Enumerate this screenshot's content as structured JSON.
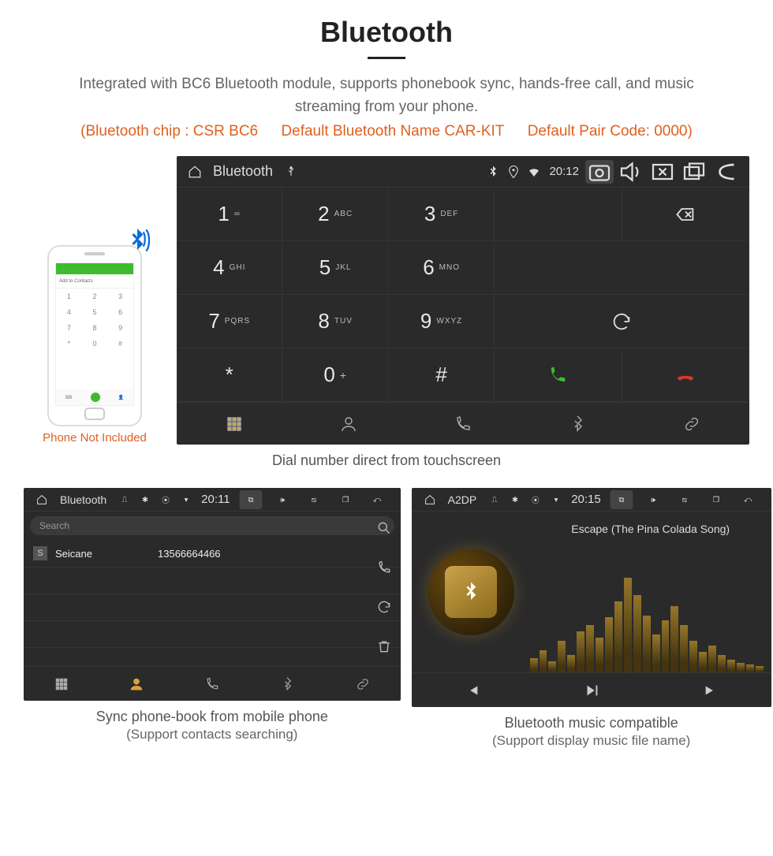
{
  "header": {
    "title": "Bluetooth",
    "subtitle": "Integrated with BC6 Bluetooth module, supports phonebook sync, hands-free call, and music streaming from your phone.",
    "spec_chip": "(Bluetooth chip : CSR BC6",
    "spec_name": "Default Bluetooth Name CAR-KIT",
    "spec_code": "Default Pair Code: 0000)"
  },
  "phone_mock": {
    "add_contacts": "Add to Contacts",
    "caption": "Phone Not Included"
  },
  "main_panel": {
    "statusbar": {
      "title": "Bluetooth",
      "time": "20:12"
    },
    "keys": [
      {
        "digit": "1",
        "letters": "∞"
      },
      {
        "digit": "2",
        "letters": "ABC"
      },
      {
        "digit": "3",
        "letters": "DEF"
      },
      {
        "digit": "4",
        "letters": "GHI"
      },
      {
        "digit": "5",
        "letters": "JKL"
      },
      {
        "digit": "6",
        "letters": "MNO"
      },
      {
        "digit": "7",
        "letters": "PQRS"
      },
      {
        "digit": "8",
        "letters": "TUV"
      },
      {
        "digit": "9",
        "letters": "WXYZ"
      },
      {
        "digit": "*",
        "letters": ""
      },
      {
        "digit": "0",
        "letters": "+",
        "plus": true
      },
      {
        "digit": "#",
        "letters": ""
      }
    ],
    "caption": "Dial number direct from touchscreen"
  },
  "contacts_panel": {
    "statusbar": {
      "title": "Bluetooth",
      "time": "20:11"
    },
    "search_placeholder": "Search",
    "rows": [
      {
        "letter": "S",
        "name": "Seicane",
        "number": "13566664466"
      }
    ],
    "caption_line1": "Sync phone-book from mobile phone",
    "caption_line2": "(Support contacts searching)"
  },
  "music_panel": {
    "statusbar": {
      "title": "A2DP",
      "time": "20:15"
    },
    "track": "Escape (The Pina Colada Song)",
    "eq_heights": [
      18,
      28,
      14,
      40,
      22,
      52,
      60,
      44,
      70,
      90,
      120,
      98,
      72,
      48,
      66,
      84,
      60,
      40,
      26,
      34,
      22,
      16,
      12,
      10,
      8
    ],
    "caption_line1": "Bluetooth music compatible",
    "caption_line2": "(Support display music file name)"
  }
}
